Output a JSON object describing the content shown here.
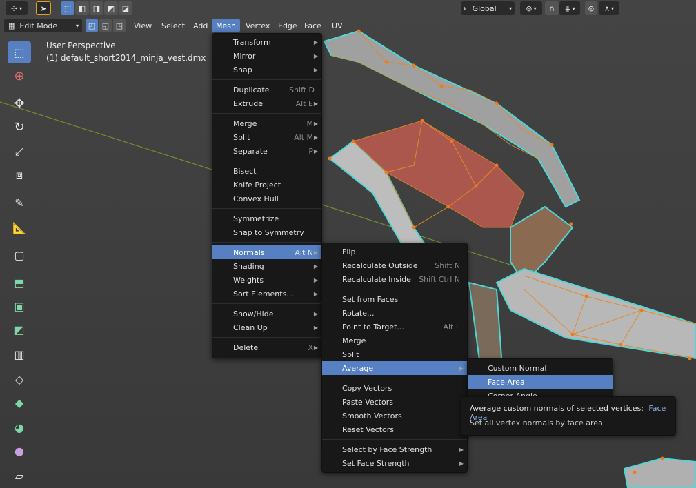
{
  "topbar": {
    "orientation_label": "Global",
    "chevron": "▾"
  },
  "header": {
    "mode_label": "Edit Mode",
    "menus": [
      "View",
      "Select",
      "Add",
      "Mesh",
      "Vertex",
      "Edge",
      "Face",
      "UV"
    ]
  },
  "viewport": {
    "perspective_label": "User Perspective",
    "object_label": "(1) default_short2014_minja_vest.dmx"
  },
  "mesh_menu": {
    "items": [
      {
        "label": "Transform",
        "shortcut": "",
        "submenu": true
      },
      {
        "label": "Mirror",
        "shortcut": "",
        "submenu": true
      },
      {
        "label": "Snap",
        "shortcut": "",
        "submenu": true
      },
      {
        "label": "Duplicate",
        "shortcut": "Shift D",
        "submenu": false
      },
      {
        "label": "Extrude",
        "shortcut": "Alt E",
        "submenu": true
      },
      {
        "label": "Merge",
        "shortcut": "M",
        "submenu": true
      },
      {
        "label": "Split",
        "shortcut": "Alt M",
        "submenu": true
      },
      {
        "label": "Separate",
        "shortcut": "P",
        "submenu": true
      },
      {
        "label": "Bisect",
        "shortcut": "",
        "submenu": false
      },
      {
        "label": "Knife Project",
        "shortcut": "",
        "submenu": false
      },
      {
        "label": "Convex Hull",
        "shortcut": "",
        "submenu": false
      },
      {
        "label": "Symmetrize",
        "shortcut": "",
        "submenu": false
      },
      {
        "label": "Snap to Symmetry",
        "shortcut": "",
        "submenu": false
      },
      {
        "label": "Normals",
        "shortcut": "Alt N",
        "submenu": true
      },
      {
        "label": "Shading",
        "shortcut": "",
        "submenu": true
      },
      {
        "label": "Weights",
        "shortcut": "",
        "submenu": true
      },
      {
        "label": "Sort Elements...",
        "shortcut": "",
        "submenu": true
      },
      {
        "label": "Show/Hide",
        "shortcut": "",
        "submenu": true
      },
      {
        "label": "Clean Up",
        "shortcut": "",
        "submenu": true
      },
      {
        "label": "Delete",
        "shortcut": "X",
        "submenu": true
      }
    ]
  },
  "normals_menu": {
    "items": [
      {
        "label": "Flip",
        "shortcut": "",
        "submenu": false
      },
      {
        "label": "Recalculate Outside",
        "shortcut": "Shift N",
        "submenu": false
      },
      {
        "label": "Recalculate Inside",
        "shortcut": "Shift Ctrl N",
        "submenu": false
      },
      {
        "label": "Set from Faces",
        "shortcut": "",
        "submenu": false
      },
      {
        "label": "Rotate...",
        "shortcut": "",
        "submenu": false
      },
      {
        "label": "Point to Target...",
        "shortcut": "Alt L",
        "submenu": false
      },
      {
        "label": "Merge",
        "shortcut": "",
        "submenu": false
      },
      {
        "label": "Split",
        "shortcut": "",
        "submenu": false
      },
      {
        "label": "Average",
        "shortcut": "",
        "submenu": true
      },
      {
        "label": "Copy Vectors",
        "shortcut": "",
        "submenu": false
      },
      {
        "label": "Paste Vectors",
        "shortcut": "",
        "submenu": false
      },
      {
        "label": "Smooth Vectors",
        "shortcut": "",
        "submenu": false
      },
      {
        "label": "Reset Vectors",
        "shortcut": "",
        "submenu": false
      },
      {
        "label": "Select by Face Strength",
        "shortcut": "",
        "submenu": true
      },
      {
        "label": "Set Face Strength",
        "shortcut": "",
        "submenu": true
      }
    ]
  },
  "average_menu": {
    "items": [
      {
        "label": "Custom Normal"
      },
      {
        "label": "Face Area"
      },
      {
        "label": "Corner Angle"
      }
    ]
  },
  "tooltip": {
    "title": "Average custom normals of selected vertices:",
    "value": "Face Area",
    "description": "Set all vertex normals by face area"
  },
  "colors": {
    "accent": "#5680c2",
    "menu_bg": "#181818",
    "viewport_bg": "#3d3d3d",
    "mesh_edge": "#e08a2a",
    "mesh_outline": "#4fd6d6",
    "selected_face": "#b85a50"
  }
}
